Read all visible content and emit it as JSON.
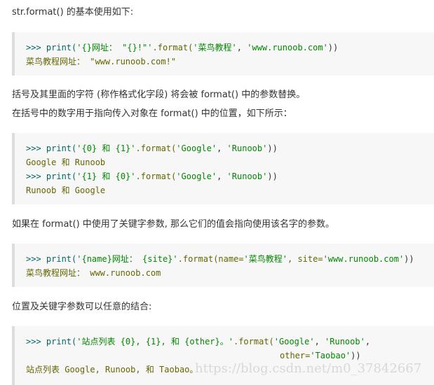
{
  "paragraphs": {
    "p1": "str.format() 的基本使用如下:",
    "p2": "括号及其里面的字符 (称作格式化字段) 将会被 format() 中的参数替换。",
    "p3": "在括号中的数字用于指向传入对象在 format() 中的位置，如下所示：",
    "p4": "如果在 format() 中使用了关键字参数, 那么它们的值会指向使用该名字的参数。",
    "p5": "位置及关键字参数可以任意的结合:"
  },
  "code1": {
    "l1_prompt": ">>> print(",
    "l1_str": "'{}网址： \"{}!\"'",
    "l1_fmt": ".format(",
    "l1_a1": "'菜鸟教程'",
    "l1_sep": ", ",
    "l1_a2": "'www.runoob.com'",
    "l1_end": "))",
    "l2": "菜鸟教程网址： \"www.runoob.com!\""
  },
  "code2": {
    "l1_prompt": ">>> print(",
    "l1_str": "'{0} 和 {1}'",
    "l1_fmt": ".format(",
    "l1_a1": "'Google'",
    "l1_sep": ", ",
    "l1_a2": "'Runoob'",
    "l1_end": "))",
    "l2": "Google 和 Runoob",
    "l3_prompt": ">>> print(",
    "l3_str": "'{1} 和 {0}'",
    "l3_fmt": ".format(",
    "l3_a1": "'Google'",
    "l3_sep": ", ",
    "l3_a2": "'Runoob'",
    "l3_end": "))",
    "l4": "Runoob 和 Google"
  },
  "code3": {
    "l1_prompt": ">>> print(",
    "l1_str": "'{name}网址： {site}'",
    "l1_fmt": ".format(name=",
    "l1_a1": "'菜鸟教程'",
    "l1_sep": ", site=",
    "l1_a2": "'www.runoob.com'",
    "l1_end": "))",
    "l2": "菜鸟教程网址： www.runoob.com"
  },
  "code4": {
    "l1_prompt": ">>> print(",
    "l1_str": "'站点列表 {0}, {1}, 和 {other}。'",
    "l1_fmt": ".format(",
    "l1_a1": "'Google'",
    "l1_sep": ", ",
    "l1_a2": "'Runoob'",
    "l1_end": ",",
    "l2_kw": "other=",
    "l2_a": "'Taobao'",
    "l2_end": "))",
    "l3": "站点列表 Google, Runoob, 和 Taobao。"
  },
  "watermark": "https://blog.csdn.net/m0_37842667"
}
